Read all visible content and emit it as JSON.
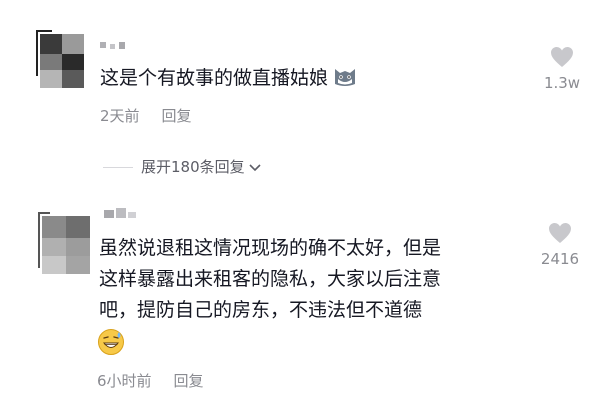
{
  "comments": [
    {
      "text_lines": [
        "这是个有故事的做直播姑娘"
      ],
      "time": "2天前",
      "reply_label": "回复",
      "expand_label": "展开180条回复",
      "like_count": "1.3w",
      "emoji": "cat-face-emoji"
    },
    {
      "text_lines": [
        "虽然说退租这情况现场的确不太好，但是",
        "这样暴露出来租客的隐私，大家以后注意",
        "吧，提防自己的房东，不违法但不道德"
      ],
      "time": "6小时前",
      "reply_label": "回复",
      "like_count": "2416",
      "emoji": "sweat-grin-emoji"
    }
  ],
  "colors": {
    "text": "#161823",
    "meta": "#8a8b91",
    "heart": "#c8c8cc",
    "background": "#ffffff"
  }
}
